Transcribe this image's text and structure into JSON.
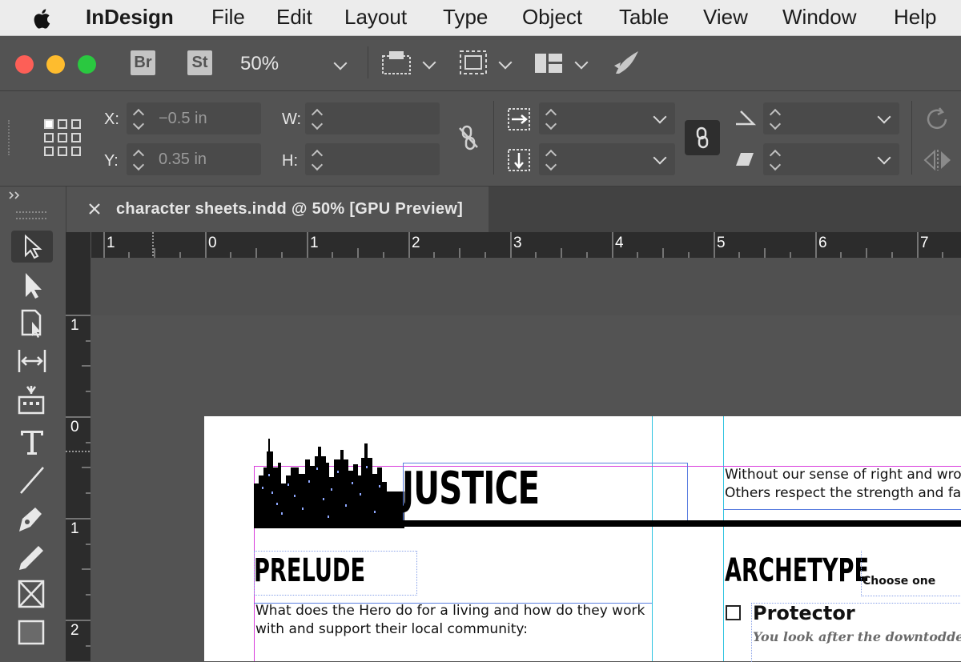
{
  "menubar": {
    "app_name": "InDesign",
    "items": [
      "File",
      "Edit",
      "Layout",
      "Type",
      "Object",
      "Table",
      "View",
      "Window",
      "Help"
    ]
  },
  "appbar": {
    "bridge_label": "Br",
    "stock_label": "St",
    "zoom": "50%"
  },
  "control_panel": {
    "x_label": "X:",
    "x_value": "−0.5 in",
    "y_label": "Y:",
    "y_value": "0.35 in",
    "w_label": "W:",
    "w_value": "",
    "h_label": "H:",
    "h_value": ""
  },
  "document_tab": {
    "title": "character sheets.indd @ 50% [GPU Preview]"
  },
  "rulers": {
    "horizontal": [
      "1",
      "0",
      "1",
      "2",
      "3",
      "4",
      "5",
      "6",
      "7"
    ],
    "vertical": [
      "1",
      "0",
      "1",
      "2"
    ]
  },
  "page": {
    "title": "JUSTICE",
    "intro_line1": "Without our sense of right and wron",
    "intro_line2": "Others respect the strength and fair",
    "prelude_heading": "PRELUDE",
    "prelude_line1": "What does the Hero do for a living and how do they work",
    "prelude_line2": "with and support their local community:",
    "archetype_heading": "ARCHETYPE",
    "archetype_hint": "Choose one",
    "option_title": "Protector",
    "option_desc": "You look after the downtodden an"
  },
  "colors": {
    "menubar_bg": "#ececec",
    "panel_bg": "#535353",
    "guide": "#2ec3e0",
    "frame_magenta": "#d83adc",
    "frame_blue": "#5b7fe0"
  },
  "icons": [
    "apple-icon",
    "grid-icon",
    "frame-fit-icon",
    "layout-icon",
    "publish-icon",
    "reference-point-icon",
    "constrain-icon",
    "chain-icon",
    "shear-icon",
    "rotate-icon",
    "flip-icon",
    "close-icon",
    "selection-tool-icon",
    "direct-selection-tool-icon",
    "page-tool-icon",
    "gap-tool-icon",
    "content-collector-icon",
    "type-tool-icon",
    "line-tool-icon",
    "pen-tool-icon",
    "pencil-tool-icon",
    "rectangle-frame-tool-icon",
    "rectangle-tool-icon"
  ]
}
